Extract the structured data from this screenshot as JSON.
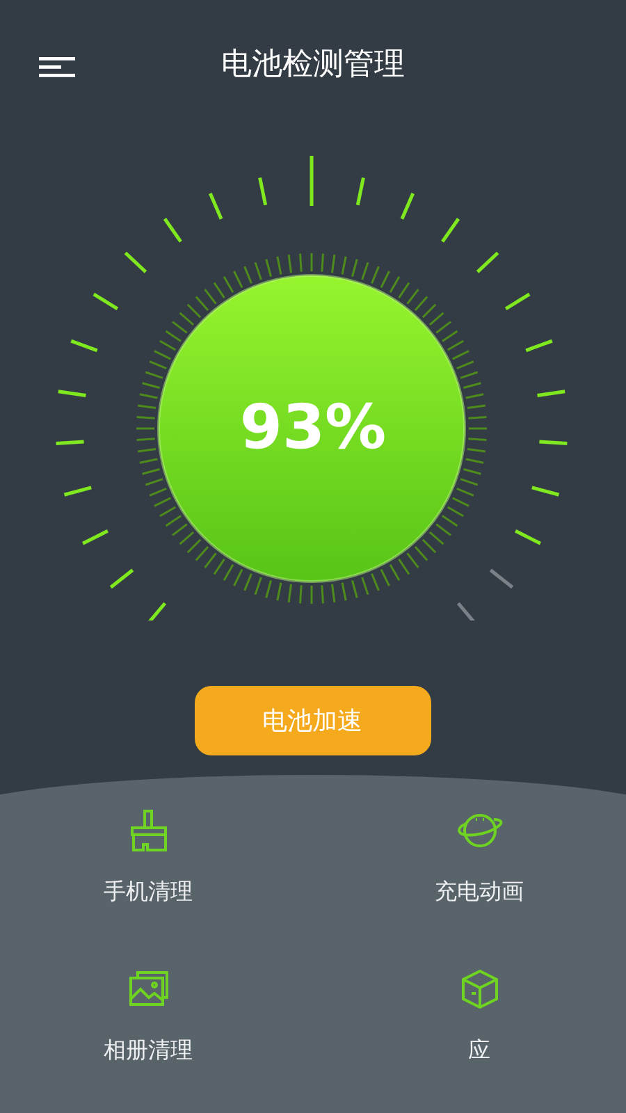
{
  "header": {
    "title": "电池检测管理"
  },
  "battery": {
    "reading": "93%",
    "level": 0.93
  },
  "boost_button": {
    "label": "电池加速"
  },
  "tools": [
    {
      "label": "手机清理",
      "kind": "brush"
    },
    {
      "label": "充电动画",
      "kind": "planet"
    },
    {
      "label": "相册清理",
      "kind": "photos"
    },
    {
      "label": "应",
      "kind": "box"
    }
  ]
}
